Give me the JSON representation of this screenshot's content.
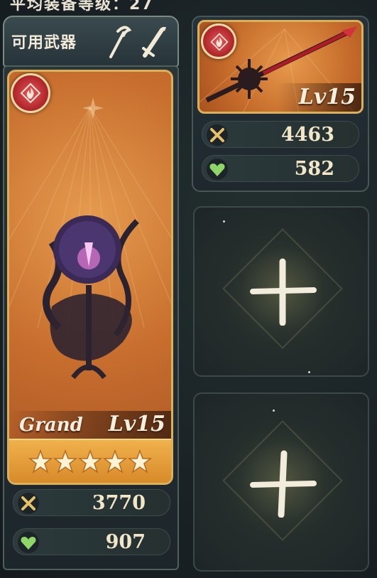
{
  "header": {
    "average_level_text": "平均装备等级：27"
  },
  "weapon_type": {
    "label": "可用武器",
    "icons": [
      "staff-icon",
      "sword-icon"
    ]
  },
  "main_weapon": {
    "element": "fire",
    "element_color": "#c8383c",
    "rarity_label": "Grand",
    "level": "Lv15",
    "stars": 5,
    "attack": "3770",
    "hp": "907"
  },
  "secondary_weapon": {
    "element": "fire",
    "level": "Lv15",
    "attack": "4463",
    "hp": "582"
  },
  "empty_slots": [
    {
      "icon": "plus-icon"
    },
    {
      "icon": "plus-icon"
    }
  ],
  "colors": {
    "card_gold": "#d9b05b",
    "card_orange": "#c86f2f",
    "panel_dark": "#1d262a",
    "hp_green": "#8fd66a",
    "attack_gold": "#e6c06a"
  }
}
